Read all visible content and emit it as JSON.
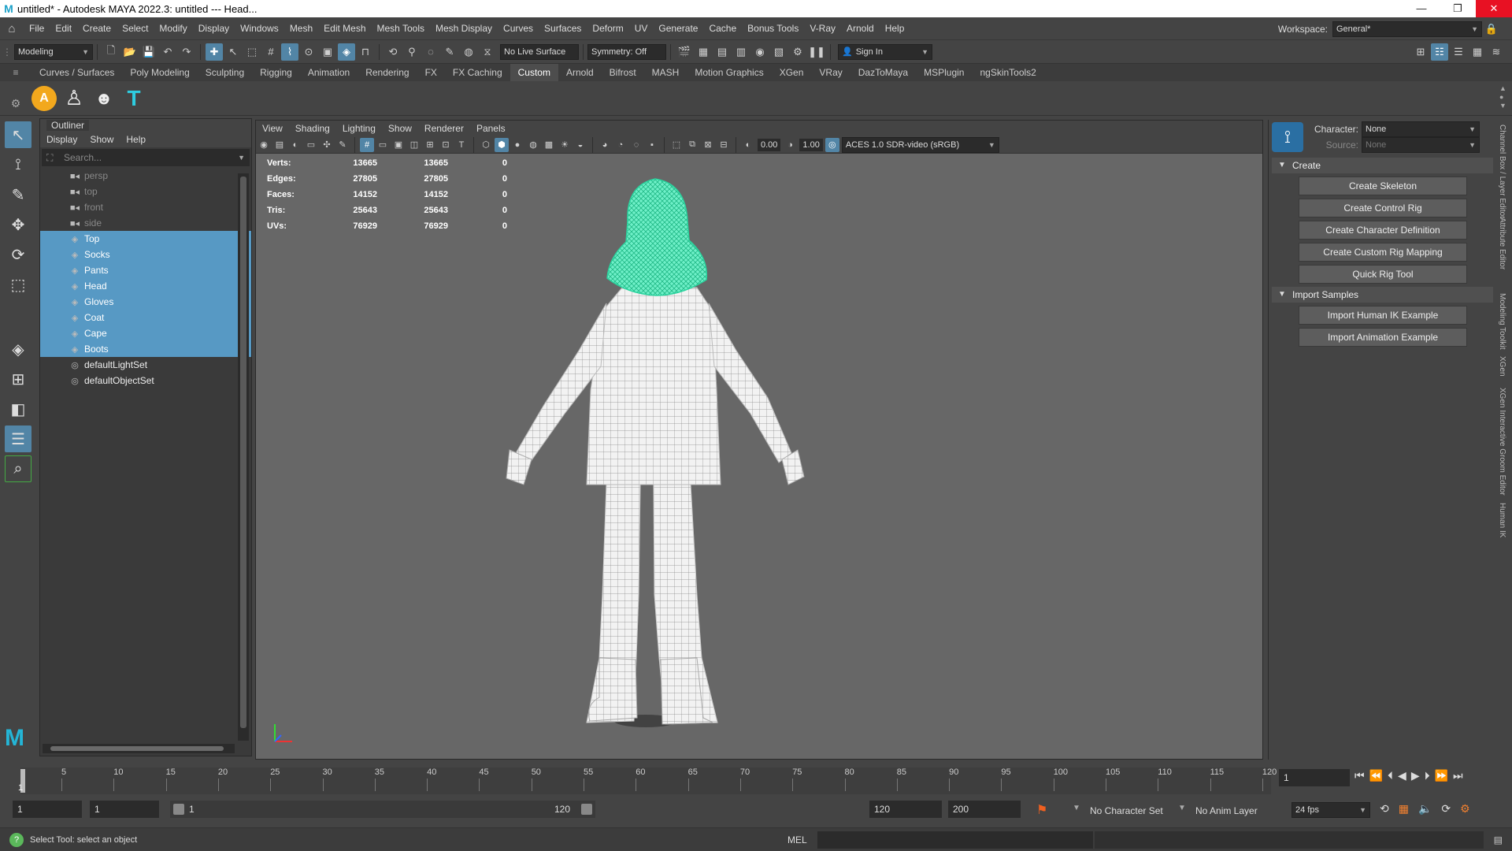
{
  "title": "untitled* - Autodesk MAYA 2022.3: untitled   ---   Head...",
  "menu": [
    "File",
    "Edit",
    "Create",
    "Select",
    "Modify",
    "Display",
    "Windows",
    "Mesh",
    "Edit Mesh",
    "Mesh Tools",
    "Mesh Display",
    "Curves",
    "Surfaces",
    "Deform",
    "UV",
    "Generate",
    "Cache",
    "Bonus Tools",
    "V-Ray",
    "Arnold",
    "Help"
  ],
  "workspace": {
    "label": "Workspace:",
    "value": "General*"
  },
  "status": {
    "mode": "Modeling",
    "live_surface": "No Live Surface",
    "symmetry": "Symmetry: Off",
    "sign_in": "Sign In"
  },
  "shelf_tabs": [
    "Curves / Surfaces",
    "Poly Modeling",
    "Sculpting",
    "Rigging",
    "Animation",
    "Rendering",
    "FX",
    "FX Caching",
    "Custom",
    "Arnold",
    "Bifrost",
    "MASH",
    "Motion Graphics",
    "XGen",
    "VRay",
    "DazToMaya",
    "MSPlugin",
    "ngSkinTools2"
  ],
  "shelf_active": "Custom",
  "outliner": {
    "title": "Outliner",
    "menu": [
      "Display",
      "Show",
      "Help"
    ],
    "search_placeholder": "Search...",
    "items": [
      {
        "label": "persp",
        "icon": "camera-icon",
        "state": "dim"
      },
      {
        "label": "top",
        "icon": "camera-icon",
        "state": "dim"
      },
      {
        "label": "front",
        "icon": "camera-icon",
        "state": "dim"
      },
      {
        "label": "side",
        "icon": "camera-icon",
        "state": "dim"
      },
      {
        "label": "Top",
        "icon": "mesh-icon",
        "state": "sel"
      },
      {
        "label": "Socks",
        "icon": "mesh-icon",
        "state": "sel"
      },
      {
        "label": "Pants",
        "icon": "mesh-icon",
        "state": "sel"
      },
      {
        "label": "Head",
        "icon": "mesh-icon",
        "state": "sel"
      },
      {
        "label": "Gloves",
        "icon": "mesh-icon",
        "state": "sel"
      },
      {
        "label": "Coat",
        "icon": "mesh-icon",
        "state": "sel"
      },
      {
        "label": "Cape",
        "icon": "mesh-icon",
        "state": "sel"
      },
      {
        "label": "Boots",
        "icon": "mesh-icon",
        "state": "sel"
      },
      {
        "label": "defaultLightSet",
        "icon": "set-icon",
        "state": "normal"
      },
      {
        "label": "defaultObjectSet",
        "icon": "set-icon",
        "state": "normal"
      }
    ]
  },
  "viewport": {
    "menu": [
      "View",
      "Shading",
      "Lighting",
      "Show",
      "Renderer",
      "Panels"
    ],
    "field_a": "0.00",
    "field_b": "1.00",
    "colorspace": "ACES 1.0 SDR-video (sRGB)",
    "hud": [
      {
        "label": "Verts:",
        "a": "13665",
        "b": "13665",
        "c": "0"
      },
      {
        "label": "Edges:",
        "a": "27805",
        "b": "27805",
        "c": "0"
      },
      {
        "label": "Faces:",
        "a": "14152",
        "b": "14152",
        "c": "0"
      },
      {
        "label": "Tris:",
        "a": "25643",
        "b": "25643",
        "c": "0"
      },
      {
        "label": "UVs:",
        "a": "76929",
        "b": "76929",
        "c": "0"
      }
    ]
  },
  "hik": {
    "character_label": "Character:",
    "character": "None",
    "source_label": "Source:",
    "source": "None",
    "create_title": "Create",
    "create_buttons": [
      "Create Skeleton",
      "Create Control Rig",
      "Create Character Definition",
      "Create Custom Rig Mapping",
      "Quick Rig Tool"
    ],
    "import_title": "Import Samples",
    "import_buttons": [
      "Import Human IK Example",
      "Import Animation Example"
    ]
  },
  "side_tabs": [
    "Channel Box / Layer Editor",
    "Attribute Editor",
    "Modeling Toolkit",
    "XGen",
    "XGen Interactive Groom Editor",
    "Human IK"
  ],
  "timeline": {
    "ticks": [
      "5",
      "10",
      "15",
      "20",
      "25",
      "30",
      "35",
      "40",
      "45",
      "50",
      "55",
      "60",
      "65",
      "70",
      "75",
      "80",
      "85",
      "90",
      "95",
      "100",
      "105",
      "110",
      "115",
      "120"
    ],
    "current": "1",
    "current_frame_field": "1"
  },
  "range": {
    "start": "1",
    "playback_start": "1",
    "slider_start": "1",
    "slider_end": "120",
    "playback_end": "120",
    "end": "200",
    "character_set": "No Character Set",
    "anim_layer": "No Anim Layer",
    "fps": "24 fps"
  },
  "command": {
    "help": "Select Tool: select an object",
    "lang": "MEL"
  },
  "colors": {
    "accent": "#5799c4",
    "selected_mesh": "#3ee0b0",
    "wire": "#ffffff"
  }
}
